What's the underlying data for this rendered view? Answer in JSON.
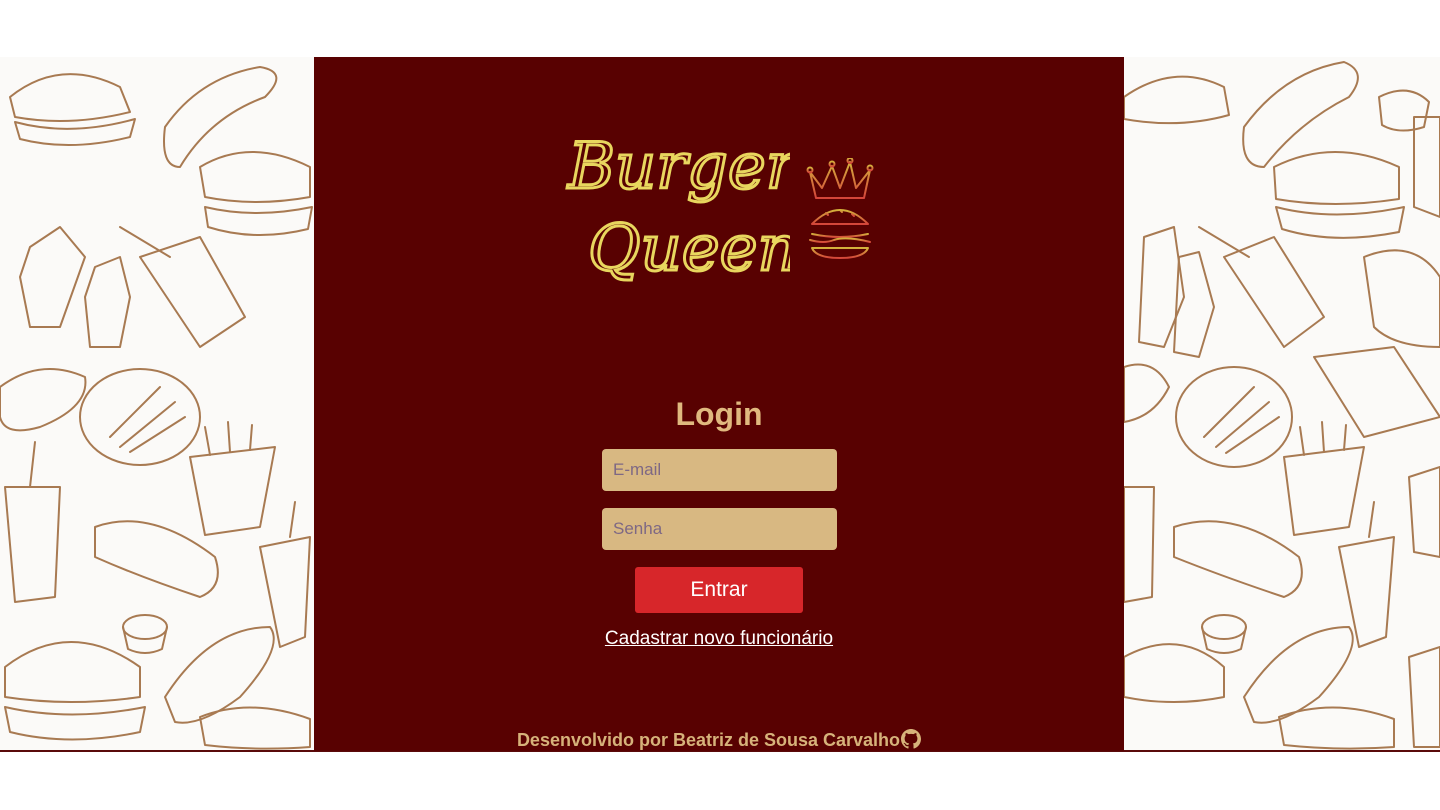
{
  "brand": {
    "line1": "Burger",
    "line2": "Queen",
    "logo_icon": "crown-burger-icon",
    "accent_color": "#e8d65e"
  },
  "background": {
    "pattern": "fast-food line drawings",
    "line_color": "#a87a52",
    "panel_color": "#580101"
  },
  "login": {
    "title": "Login",
    "email_placeholder": "E-mail",
    "password_placeholder": "Senha",
    "submit_label": "Entrar",
    "register_link": "Cadastrar novo funcionário"
  },
  "footer": {
    "text": "Desenvolvido por Beatriz de Sousa Carvalho",
    "icon": "github-icon"
  }
}
